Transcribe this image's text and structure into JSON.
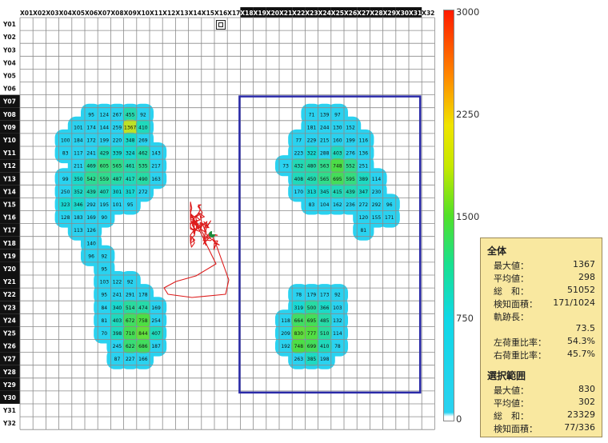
{
  "grid": {
    "columns": [
      "X01",
      "X02",
      "X03",
      "X04",
      "X05",
      "X06",
      "X07",
      "X08",
      "X09",
      "X10",
      "X11",
      "X12",
      "X13",
      "X14",
      "X15",
      "X16",
      "X17",
      "X18",
      "X19",
      "X20",
      "X21",
      "X22",
      "X23",
      "X24",
      "X25",
      "X26",
      "X27",
      "X28",
      "X29",
      "X30",
      "X31",
      "X32"
    ],
    "rows": [
      "Y01",
      "Y02",
      "Y03",
      "Y04",
      "Y05",
      "Y06",
      "Y07",
      "Y08",
      "Y09",
      "Y10",
      "Y11",
      "Y12",
      "Y13",
      "Y14",
      "Y15",
      "Y16",
      "Y17",
      "Y18",
      "Y19",
      "Y20",
      "Y21",
      "Y22",
      "Y23",
      "Y24",
      "Y25",
      "Y26",
      "Y27",
      "Y28",
      "Y29",
      "Y30",
      "Y31",
      "Y32"
    ],
    "highlighted_columns": [
      "X18",
      "X19",
      "X20",
      "X21",
      "X22",
      "X23",
      "X24",
      "X25",
      "X26",
      "X27",
      "X28",
      "X29",
      "X30",
      "X31"
    ],
    "highlighted_rows": [
      "Y07",
      "Y08",
      "Y09",
      "Y10",
      "Y11",
      "Y12",
      "Y13",
      "Y14",
      "Y15",
      "Y16",
      "Y17",
      "Y18",
      "Y19",
      "Y20",
      "Y21",
      "Y22",
      "Y23",
      "Y24",
      "Y25",
      "Y26",
      "Y27",
      "Y28",
      "Y29",
      "Y30"
    ],
    "selection": {
      "col_start": "X18",
      "col_end": "X31",
      "row_start": "Y07",
      "row_end": "Y29"
    },
    "cells": [
      [
        "Y08",
        "X06",
        "95"
      ],
      [
        "Y08",
        "X07",
        "124"
      ],
      [
        "Y08",
        "X08",
        "267"
      ],
      [
        "Y08",
        "X09",
        "455"
      ],
      [
        "Y08",
        "X10",
        "92"
      ],
      [
        "Y09",
        "X05",
        "101"
      ],
      [
        "Y09",
        "X06",
        "174"
      ],
      [
        "Y09",
        "X07",
        "144"
      ],
      [
        "Y09",
        "X08",
        "259"
      ],
      [
        "Y09",
        "X09",
        "1367"
      ],
      [
        "Y09",
        "X10",
        "410"
      ],
      [
        "Y10",
        "X04",
        "100"
      ],
      [
        "Y10",
        "X05",
        "184"
      ],
      [
        "Y10",
        "X06",
        "172"
      ],
      [
        "Y10",
        "X07",
        "199"
      ],
      [
        "Y10",
        "X08",
        "220"
      ],
      [
        "Y10",
        "X09",
        "348"
      ],
      [
        "Y10",
        "X10",
        "269"
      ],
      [
        "Y11",
        "X04",
        "83"
      ],
      [
        "Y11",
        "X05",
        "117"
      ],
      [
        "Y11",
        "X06",
        "241"
      ],
      [
        "Y11",
        "X07",
        "429"
      ],
      [
        "Y11",
        "X08",
        "339"
      ],
      [
        "Y11",
        "X09",
        "324"
      ],
      [
        "Y11",
        "X10",
        "462"
      ],
      [
        "Y11",
        "X11",
        "143"
      ],
      [
        "Y12",
        "X05",
        "211"
      ],
      [
        "Y12",
        "X06",
        "469"
      ],
      [
        "Y12",
        "X07",
        "605"
      ],
      [
        "Y12",
        "X08",
        "565"
      ],
      [
        "Y12",
        "X09",
        "461"
      ],
      [
        "Y12",
        "X10",
        "535"
      ],
      [
        "Y12",
        "X11",
        "217"
      ],
      [
        "Y13",
        "X04",
        "99"
      ],
      [
        "Y13",
        "X05",
        "350"
      ],
      [
        "Y13",
        "X06",
        "542"
      ],
      [
        "Y13",
        "X07",
        "559"
      ],
      [
        "Y13",
        "X08",
        "487"
      ],
      [
        "Y13",
        "X09",
        "417"
      ],
      [
        "Y13",
        "X10",
        "490"
      ],
      [
        "Y13",
        "X11",
        "163"
      ],
      [
        "Y14",
        "X04",
        "250"
      ],
      [
        "Y14",
        "X05",
        "352"
      ],
      [
        "Y14",
        "X06",
        "439"
      ],
      [
        "Y14",
        "X07",
        "407"
      ],
      [
        "Y14",
        "X08",
        "301"
      ],
      [
        "Y14",
        "X09",
        "317"
      ],
      [
        "Y14",
        "X10",
        "272"
      ],
      [
        "Y15",
        "X04",
        "323"
      ],
      [
        "Y15",
        "X05",
        "346"
      ],
      [
        "Y15",
        "X06",
        "292"
      ],
      [
        "Y15",
        "X07",
        "195"
      ],
      [
        "Y15",
        "X08",
        "101"
      ],
      [
        "Y15",
        "X09",
        "95"
      ],
      [
        "Y16",
        "X04",
        "128"
      ],
      [
        "Y16",
        "X05",
        "183"
      ],
      [
        "Y16",
        "X06",
        "169"
      ],
      [
        "Y16",
        "X07",
        "90"
      ],
      [
        "Y17",
        "X05",
        "113"
      ],
      [
        "Y17",
        "X06",
        "126"
      ],
      [
        "Y18",
        "X06",
        "140"
      ],
      [
        "Y19",
        "X06",
        "96"
      ],
      [
        "Y19",
        "X07",
        "92"
      ],
      [
        "Y20",
        "X07",
        "95"
      ],
      [
        "Y21",
        "X07",
        "103"
      ],
      [
        "Y21",
        "X08",
        "122"
      ],
      [
        "Y21",
        "X09",
        "92"
      ],
      [
        "Y22",
        "X07",
        "95"
      ],
      [
        "Y22",
        "X08",
        "241"
      ],
      [
        "Y22",
        "X09",
        "291"
      ],
      [
        "Y22",
        "X10",
        "178"
      ],
      [
        "Y23",
        "X07",
        "84"
      ],
      [
        "Y23",
        "X08",
        "340"
      ],
      [
        "Y23",
        "X09",
        "514"
      ],
      [
        "Y23",
        "X10",
        "474"
      ],
      [
        "Y23",
        "X11",
        "169"
      ],
      [
        "Y24",
        "X07",
        "81"
      ],
      [
        "Y24",
        "X08",
        "403"
      ],
      [
        "Y24",
        "X09",
        "672"
      ],
      [
        "Y24",
        "X10",
        "758"
      ],
      [
        "Y24",
        "X11",
        "254"
      ],
      [
        "Y25",
        "X07",
        "70"
      ],
      [
        "Y25",
        "X08",
        "398"
      ],
      [
        "Y25",
        "X09",
        "710"
      ],
      [
        "Y25",
        "X10",
        "844"
      ],
      [
        "Y25",
        "X11",
        "407"
      ],
      [
        "Y26",
        "X08",
        "245"
      ],
      [
        "Y26",
        "X09",
        "622"
      ],
      [
        "Y26",
        "X10",
        "686"
      ],
      [
        "Y26",
        "X11",
        "187"
      ],
      [
        "Y27",
        "X08",
        "87"
      ],
      [
        "Y27",
        "X09",
        "227"
      ],
      [
        "Y27",
        "X10",
        "166"
      ],
      [
        "Y08",
        "X23",
        "71"
      ],
      [
        "Y08",
        "X24",
        "139"
      ],
      [
        "Y08",
        "X25",
        "97"
      ],
      [
        "Y09",
        "X23",
        "181"
      ],
      [
        "Y09",
        "X24",
        "244"
      ],
      [
        "Y09",
        "X25",
        "130"
      ],
      [
        "Y09",
        "X26",
        "152"
      ],
      [
        "Y10",
        "X22",
        "77"
      ],
      [
        "Y10",
        "X23",
        "229"
      ],
      [
        "Y10",
        "X24",
        "215"
      ],
      [
        "Y10",
        "X25",
        "160"
      ],
      [
        "Y10",
        "X26",
        "199"
      ],
      [
        "Y10",
        "X27",
        "116"
      ],
      [
        "Y11",
        "X22",
        "223"
      ],
      [
        "Y11",
        "X23",
        "322"
      ],
      [
        "Y11",
        "X24",
        "288"
      ],
      [
        "Y11",
        "X25",
        "403"
      ],
      [
        "Y11",
        "X26",
        "276"
      ],
      [
        "Y11",
        "X27",
        "136"
      ],
      [
        "Y12",
        "X21",
        "73"
      ],
      [
        "Y12",
        "X22",
        "432"
      ],
      [
        "Y12",
        "X23",
        "480"
      ],
      [
        "Y12",
        "X24",
        "563"
      ],
      [
        "Y12",
        "X25",
        "748"
      ],
      [
        "Y12",
        "X26",
        "552"
      ],
      [
        "Y12",
        "X27",
        "251"
      ],
      [
        "Y13",
        "X22",
        "408"
      ],
      [
        "Y13",
        "X23",
        "450"
      ],
      [
        "Y13",
        "X24",
        "565"
      ],
      [
        "Y13",
        "X25",
        "695"
      ],
      [
        "Y13",
        "X26",
        "595"
      ],
      [
        "Y13",
        "X27",
        "389"
      ],
      [
        "Y13",
        "X28",
        "114"
      ],
      [
        "Y14",
        "X22",
        "170"
      ],
      [
        "Y14",
        "X23",
        "313"
      ],
      [
        "Y14",
        "X24",
        "345"
      ],
      [
        "Y14",
        "X25",
        "415"
      ],
      [
        "Y14",
        "X26",
        "439"
      ],
      [
        "Y14",
        "X27",
        "347"
      ],
      [
        "Y14",
        "X28",
        "230"
      ],
      [
        "Y15",
        "X23",
        "83"
      ],
      [
        "Y15",
        "X24",
        "104"
      ],
      [
        "Y15",
        "X25",
        "162"
      ],
      [
        "Y15",
        "X26",
        "236"
      ],
      [
        "Y15",
        "X27",
        "272"
      ],
      [
        "Y15",
        "X28",
        "292"
      ],
      [
        "Y15",
        "X29",
        "96"
      ],
      [
        "Y16",
        "X27",
        "120"
      ],
      [
        "Y16",
        "X28",
        "155"
      ],
      [
        "Y16",
        "X29",
        "171"
      ],
      [
        "Y17",
        "X27",
        "81"
      ],
      [
        "Y22",
        "X22",
        "78"
      ],
      [
        "Y22",
        "X23",
        "179"
      ],
      [
        "Y22",
        "X24",
        "173"
      ],
      [
        "Y22",
        "X25",
        "92"
      ],
      [
        "Y23",
        "X22",
        "319"
      ],
      [
        "Y23",
        "X23",
        "500"
      ],
      [
        "Y23",
        "X24",
        "366"
      ],
      [
        "Y23",
        "X25",
        "103"
      ],
      [
        "Y24",
        "X21",
        "118"
      ],
      [
        "Y24",
        "X22",
        "664"
      ],
      [
        "Y24",
        "X23",
        "695"
      ],
      [
        "Y24",
        "X24",
        "485"
      ],
      [
        "Y24",
        "X25",
        "132"
      ],
      [
        "Y25",
        "X21",
        "209"
      ],
      [
        "Y25",
        "X22",
        "830"
      ],
      [
        "Y25",
        "X23",
        "777"
      ],
      [
        "Y25",
        "X24",
        "510"
      ],
      [
        "Y25",
        "X25",
        "114"
      ],
      [
        "Y26",
        "X21",
        "192"
      ],
      [
        "Y26",
        "X22",
        "748"
      ],
      [
        "Y26",
        "X23",
        "699"
      ],
      [
        "Y26",
        "X24",
        "410"
      ],
      [
        "Y26",
        "X25",
        "78"
      ],
      [
        "Y27",
        "X22",
        "263"
      ],
      [
        "Y27",
        "X23",
        "385"
      ],
      [
        "Y27",
        "X24",
        "198"
      ]
    ]
  },
  "colorbar": {
    "max": "3000",
    "t3": "2250",
    "t2": "1500",
    "t1": "750",
    "min": "0",
    "colors": [
      "#ff1a00",
      "#ff8800",
      "#f0e400",
      "#52e028",
      "#10d8e6",
      "#ffffff"
    ]
  },
  "trajectory_color": "#dd1a1a",
  "selection_color": "#2a2aa8",
  "stats": {
    "overall": {
      "title": "全体",
      "max_label": "最大値：",
      "max_value": "1367",
      "avg_label": "平均値：",
      "avg_value": "298",
      "sum_label": "総　和：",
      "sum_value": "51052",
      "area_label": "検知面積：",
      "area_value": "171/1024",
      "trail_label": "軌跡長：",
      "trail_value": "73.5",
      "left_label": "左荷重比率：",
      "left_value": "54.3%",
      "right_label": "右荷重比率：",
      "right_value": "45.7%"
    },
    "selection": {
      "title": "選択範囲",
      "max_label": "最大値：",
      "max_value": "830",
      "avg_label": "平均値：",
      "avg_value": "302",
      "sum_label": "総　和：",
      "sum_value": "23329",
      "area_label": "検知面積：",
      "area_value": "77/336"
    }
  }
}
